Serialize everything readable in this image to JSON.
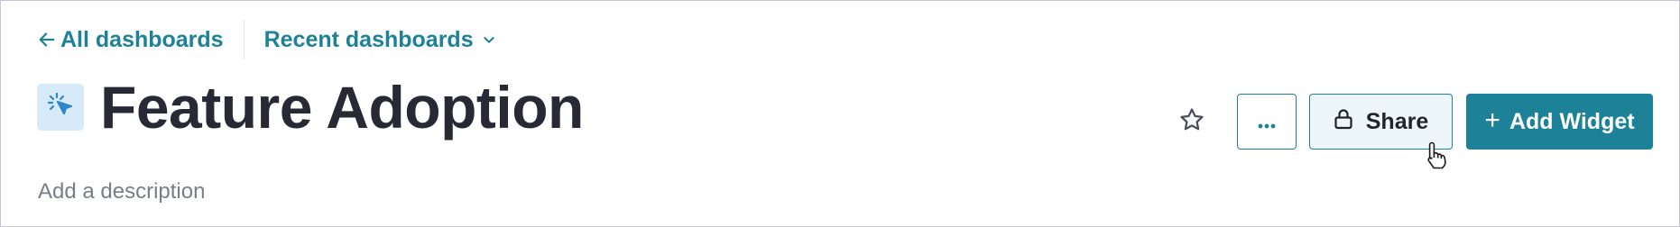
{
  "nav": {
    "back_label": "All dashboards",
    "recent_label": "Recent dashboards"
  },
  "dashboard": {
    "title": "Feature Adoption",
    "description_placeholder": "Add a description"
  },
  "actions": {
    "share_label": "Share",
    "add_widget_label": "Add Widget"
  },
  "icons": {
    "back": "arrow-left-icon",
    "recent_toggle": "chevron-down-icon",
    "dashboard": "cursor-click-icon",
    "favorite": "star-icon",
    "more": "ellipsis-icon",
    "share": "lock-icon",
    "add": "plus-icon"
  },
  "colors": {
    "accent": "#1d8297",
    "title": "#272a35",
    "icon_tile": "#d6eaf8",
    "share_bg": "#edf7fa"
  }
}
